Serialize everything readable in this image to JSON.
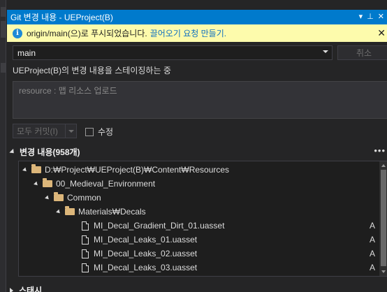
{
  "window": {
    "title": "Git 변경 내용 - UEProject(B)"
  },
  "info_bar": {
    "message": "origin/main(으)로 푸시되었습니다.",
    "link": "끌어오기 요청 만들기."
  },
  "branch": {
    "selected": "main"
  },
  "cancel_label": "취소",
  "staging_status": "UEProject(B)의 변경 내용을 스테이징하는 중",
  "commit_message": {
    "value": "resource : 맵 리소스 업로드"
  },
  "commit_button": "모두 커밋(I)",
  "amend_label": "수정",
  "changes": {
    "header": "변경 내용(958개)",
    "tree": [
      {
        "label": "D:₩Project₩UEProject(B)₩Content₩Resources",
        "kind": "folder",
        "depth": 0,
        "status": ""
      },
      {
        "label": "00_Medieval_Environment",
        "kind": "folder",
        "depth": 1,
        "status": ""
      },
      {
        "label": "Common",
        "kind": "folder",
        "depth": 2,
        "status": ""
      },
      {
        "label": "Materials₩Decals",
        "kind": "folder",
        "depth": 3,
        "status": ""
      },
      {
        "label": "MI_Decal_Gradient_Dirt_01.uasset",
        "kind": "file",
        "depth": 4,
        "status": "A"
      },
      {
        "label": "MI_Decal_Leaks_01.uasset",
        "kind": "file",
        "depth": 4,
        "status": "A"
      },
      {
        "label": "MI_Decal_Leaks_02.uasset",
        "kind": "file",
        "depth": 4,
        "status": "A"
      },
      {
        "label": "MI_Decal_Leaks_03.uasset",
        "kind": "file",
        "depth": 4,
        "status": "A"
      }
    ]
  },
  "stash_header": "스태시",
  "colors": {
    "title_bar": "#007acc",
    "info_bar": "#fdfbac",
    "folder": "#dcb67a",
    "background": "#252526"
  }
}
